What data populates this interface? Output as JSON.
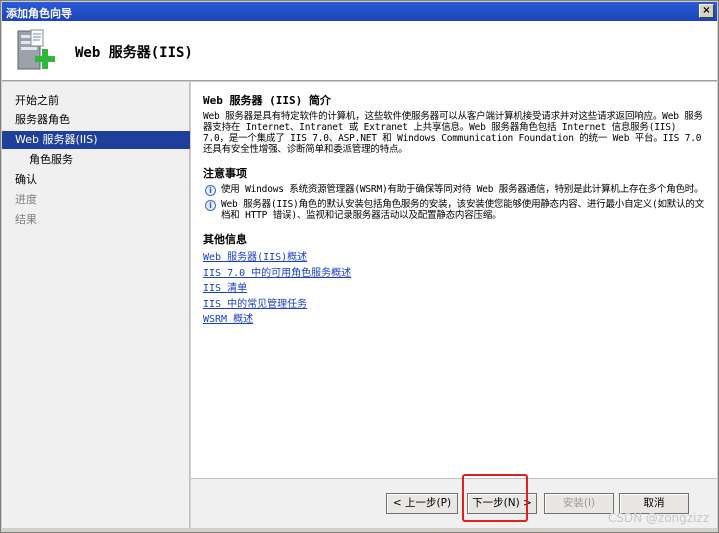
{
  "window": {
    "title": "添加角色向导",
    "close_glyph": "×"
  },
  "header": {
    "title": "Web 服务器(IIS)",
    "icon": "server-add-icon"
  },
  "sidebar": {
    "items": [
      {
        "label": "开始之前",
        "state": "normal"
      },
      {
        "label": "服务器角色",
        "state": "normal"
      },
      {
        "label": "Web 服务器(IIS)",
        "state": "active"
      },
      {
        "label": "角色服务",
        "state": "normal"
      },
      {
        "label": "确认",
        "state": "normal"
      },
      {
        "label": "进度",
        "state": "disabled"
      },
      {
        "label": "结果",
        "state": "disabled"
      }
    ]
  },
  "content": {
    "intro_title": "Web 服务器 (IIS) 简介",
    "intro_text": "Web 服务器是具有特定软件的计算机，这些软件使服务器可以从客户端计算机接受请求并对这些请求返回响应。Web 服务器支持在 Internet、Intranet 或 Extranet 上共享信息。Web 服务器角色包括 Internet 信息服务(IIS) 7.0，是一个集成了 IIS 7.0、ASP.NET 和 Windows Communication Foundation 的统一 Web 平台。IIS 7.0 还具有安全性增强、诊断简单和委派管理的特点。",
    "notes_title": "注意事项",
    "notes": [
      "使用 Windows 系统资源管理器(WSRM)有助于确保等同对待 Web 服务器通信，特别是此计算机上存在多个角色时。",
      "Web 服务器(IIS)角色的默认安装包括角色服务的安装，该安装使您能够使用静态内容、进行最小自定义(如默认的文档和 HTTP 错误)、监视和记录服务器活动以及配置静态内容压缩。"
    ],
    "more_title": "其他信息",
    "links": [
      "Web 服务器(IIS)概述",
      "IIS 7.0 中的可用角色服务概述",
      "IIS 清单",
      "IIS 中的常见管理任务",
      "WSRM 概述"
    ]
  },
  "footer": {
    "back_label": "< 上一步(P)",
    "next_label": "下一步(N) >",
    "install_label": "安装(I)",
    "cancel_label": "取消"
  },
  "watermark": "CSDN @zongzizz",
  "colors": {
    "highlight": "#e0201c",
    "active_nav": "#1f3f9a",
    "link": "#1a3fbf"
  }
}
